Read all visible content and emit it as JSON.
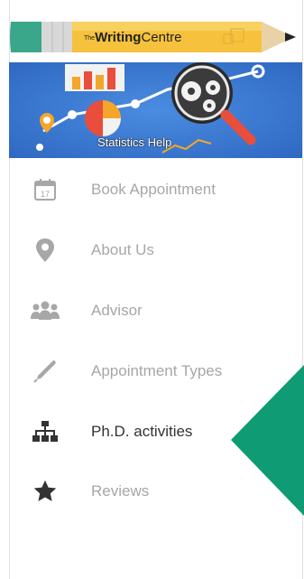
{
  "logo": {
    "prefix": "The",
    "bold": "Writing",
    "normal": "Centre"
  },
  "banner": {
    "caption": "Statistics Help"
  },
  "menu": [
    {
      "label": "Book Appointment",
      "icon": "calendar-icon",
      "calendar_day": "17",
      "active": false
    },
    {
      "label": "About Us",
      "icon": "map-pin-icon",
      "active": false
    },
    {
      "label": "Advisor",
      "icon": "users-icon",
      "active": false
    },
    {
      "label": "Appointment Types",
      "icon": "pen-icon",
      "active": false
    },
    {
      "label": "Ph.D. activities",
      "icon": "sitemap-icon",
      "active": true
    },
    {
      "label": "Reviews",
      "icon": "star-icon",
      "active": false
    }
  ],
  "colors": {
    "accent_pointer": "#0f9b74",
    "banner_blue": "#3a7bd5",
    "muted_text": "#a7a7a7",
    "active_text": "#333333"
  }
}
